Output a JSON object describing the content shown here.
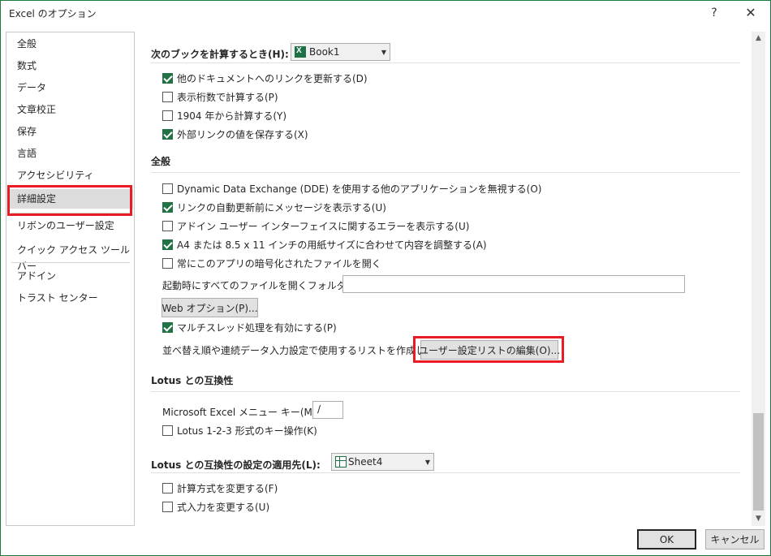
{
  "window": {
    "title": "Excel のオプション",
    "help_glyph": "?",
    "close_glyph": "✕"
  },
  "sidebar": {
    "items": [
      {
        "label": "全般"
      },
      {
        "label": "数式"
      },
      {
        "label": "データ"
      },
      {
        "label": "文章校正"
      },
      {
        "label": "保存"
      },
      {
        "label": "言語"
      },
      {
        "label": "アクセシビリティ"
      },
      {
        "label": "詳細設定",
        "selected": true
      },
      {
        "label": "リボンのユーザー設定"
      },
      {
        "label": "クイック アクセス ツール バー"
      },
      {
        "label": "アドイン"
      },
      {
        "label": "トラスト センター"
      }
    ]
  },
  "calc_section": {
    "title": "次のブックを計算するとき(H):",
    "workbook_dropdown": "Book1",
    "options": [
      {
        "label": "他のドキュメントへのリンクを更新する(D)",
        "checked": true
      },
      {
        "label": "表示桁数で計算する(P)",
        "checked": false
      },
      {
        "label": "1904 年から計算する(Y)",
        "checked": false
      },
      {
        "label": "外部リンクの値を保存する(X)",
        "checked": true
      }
    ]
  },
  "general_section": {
    "title": "全般",
    "options": [
      {
        "label": "Dynamic Data Exchange (DDE) を使用する他のアプリケーションを無視する(O)",
        "checked": false
      },
      {
        "label": "リンクの自動更新前にメッセージを表示する(U)",
        "checked": true
      },
      {
        "label": "アドイン ユーザー インターフェイスに関するエラーを表示する(U)",
        "checked": false
      },
      {
        "label": "A4 または 8.5 x 11 インチの用紙サイズに合わせて内容を調整する(A)",
        "checked": true
      },
      {
        "label": "常にこのアプリの暗号化されたファイルを開く",
        "checked": false
      }
    ],
    "startup_folder_label": "起動時にすべてのファイルを開くフォルダー(L):",
    "startup_folder_value": "",
    "web_options_button": "Web オプション(P)...",
    "multithread_option": {
      "label": "マルチスレッド処理を有効にする(P)",
      "checked": true
    },
    "custom_list_label": "並べ替え順や連続データ入力設定で使用するリストを作成します:",
    "custom_list_button": "ユーザー設定リストの編集(O)..."
  },
  "lotus_section": {
    "title": "Lotus との互換性",
    "menu_key_label": "Microsoft Excel メニュー キー(M):",
    "menu_key_value": "/",
    "option": {
      "label": "Lotus 1-2-3 形式のキー操作(K)",
      "checked": false
    }
  },
  "lotus_apply_section": {
    "title": "Lotus との互換性の設定の適用先(L):",
    "sheet_dropdown": "Sheet4",
    "options": [
      {
        "label": "計算方式を変更する(F)",
        "checked": false
      },
      {
        "label": "式入力を変更する(U)",
        "checked": false
      }
    ]
  },
  "footer": {
    "ok_label": "OK",
    "cancel_label": "キャンセル"
  },
  "colors": {
    "accent_green": "#217346",
    "highlight_red": "#e81c24",
    "selected_bg": "#dcdcdc"
  },
  "icons": {
    "workbook_dropdown_icon": "excel-workbook-icon",
    "sheet_dropdown_icon": "sheet-icon",
    "scroll_up": "chevron-up-icon",
    "scroll_down": "chevron-down-icon"
  }
}
